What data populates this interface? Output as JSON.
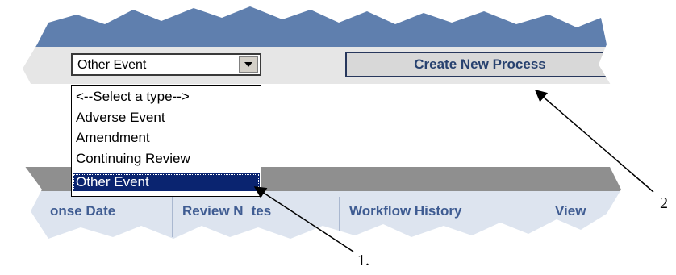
{
  "type_select": {
    "value": "Other Event",
    "options": [
      "<--Select a type-->",
      "Adverse Event",
      "Amendment",
      "Continuing Review",
      "Other Event"
    ],
    "selected_index": 4
  },
  "create_button": {
    "label": "Create New Process"
  },
  "table_headers": [
    "Response Date",
    "Review Notes",
    "Workflow History",
    "View"
  ],
  "table_headers_visible": [
    "onse Date",
    "Review N",
    "tes",
    "Workflow History",
    "View"
  ],
  "callouts": {
    "one": "1.",
    "two": "2"
  },
  "colors": {
    "header_band": "#5f7fae",
    "selected_option": "#0a2470",
    "button_text": "#27416f"
  }
}
